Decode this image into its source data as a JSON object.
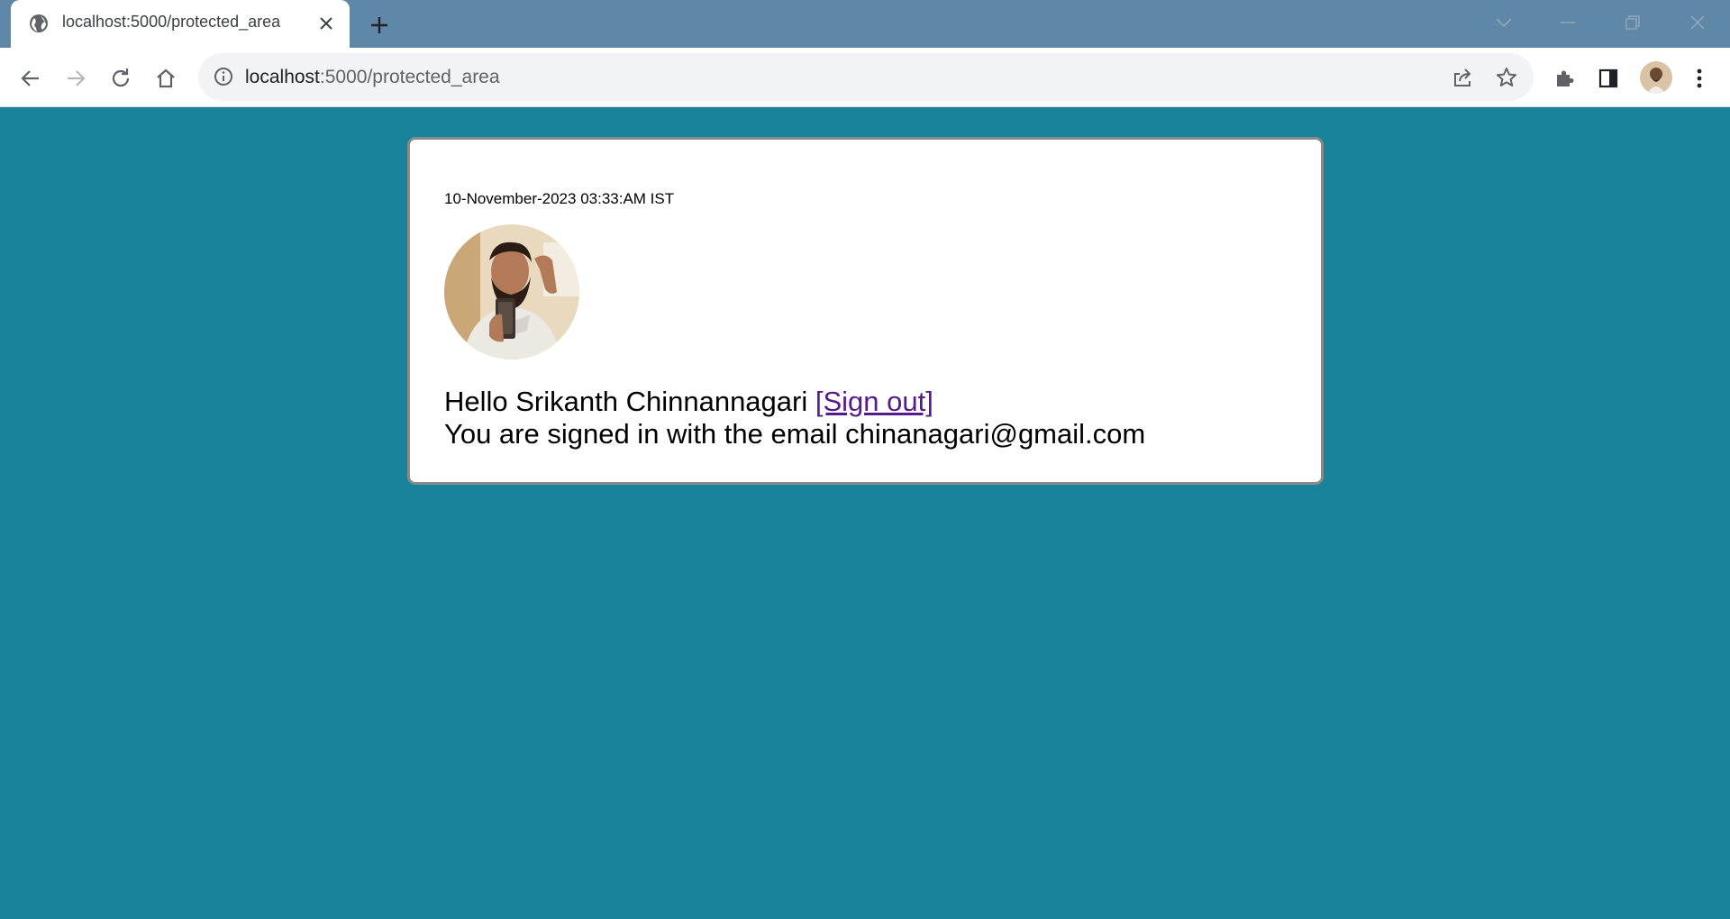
{
  "browser": {
    "tab_title": "localhost:5000/protected_area",
    "url_host": "localhost",
    "url_path": ":5000/protected_area"
  },
  "page": {
    "background_color": "#18839b",
    "timestamp": "10-November-2023 03:33:AM IST",
    "greeting_prefix": "Hello Srikanth Chinnannagari ",
    "signout_label": "[Sign out]",
    "email_line": "You are signed in with the email chinanagari@gmail.com",
    "link_color": "#551a8b"
  }
}
